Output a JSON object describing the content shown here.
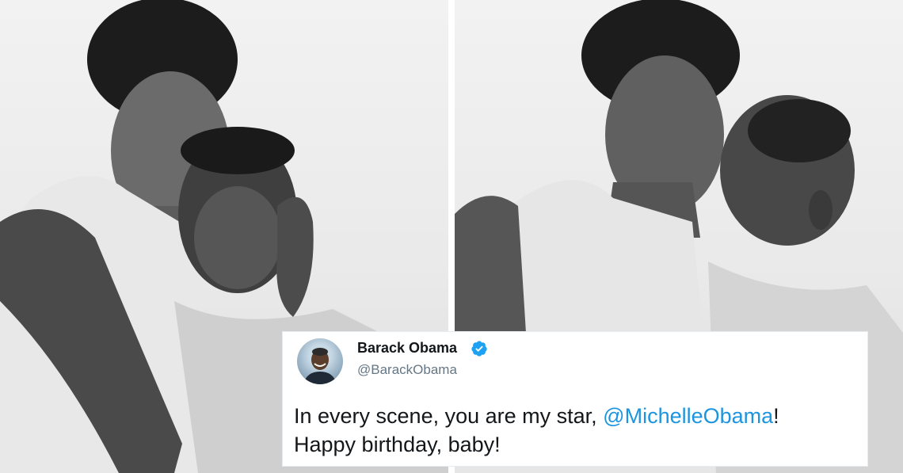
{
  "tweet": {
    "display_name": "Barack Obama",
    "handle": "@BarackObama",
    "text_part1": "In every scene, you are my star, ",
    "mention": "@MichelleObama",
    "text_part2": "!",
    "text_line2": "Happy birthday, baby!",
    "verified_icon": "verified-badge-icon",
    "colors": {
      "name": "#14171a",
      "handle": "#657786",
      "mention": "#1b95e0",
      "verified": "#1da1f2"
    }
  },
  "photos": {
    "left": "black-and-white-photo-couple-embracing",
    "right": "black-and-white-photo-couple-kiss-on-cheek"
  }
}
